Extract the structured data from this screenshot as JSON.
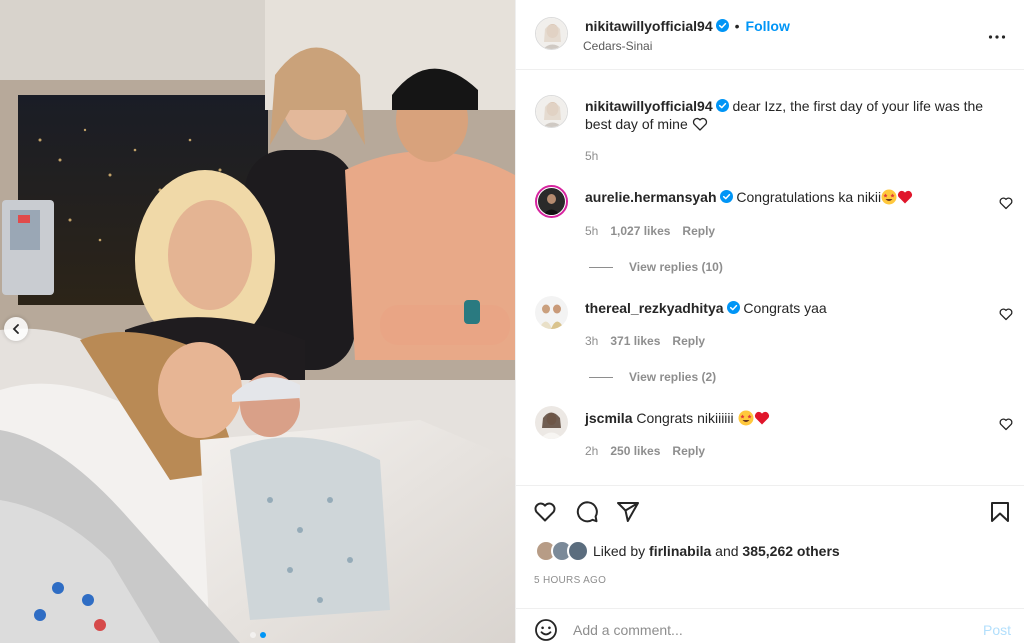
{
  "post": {
    "author": "nikitawillyofficial94",
    "follow_label": "Follow",
    "separator": "•",
    "location": "Cedars-Sinai",
    "caption": {
      "username": "nikitawillyofficial94",
      "text": "dear Izz, the first day of your life was the best day of mine",
      "time": "5h"
    }
  },
  "comments": [
    {
      "username": "aurelie.hermansyah",
      "verified": true,
      "text": "Congratulations ka nikii",
      "emojis": [
        "star-struck-emoji",
        "red-heart-emoji"
      ],
      "time": "5h",
      "likes": "1,027 likes",
      "reply_label": "Reply",
      "view_replies": "View replies (10)"
    },
    {
      "username": "thereal_rezkyadhitya",
      "verified": true,
      "text": "Congrats yaa",
      "emojis": [],
      "time": "3h",
      "likes": "371 likes",
      "reply_label": "Reply",
      "view_replies": "View replies (2)"
    },
    {
      "username": "jscmila",
      "verified": false,
      "text": "Congrats nikiiiiii",
      "emojis": [
        "star-struck-emoji",
        "red-heart-emoji"
      ],
      "time": "2h",
      "likes": "250 likes",
      "reply_label": "Reply",
      "view_replies": ""
    }
  ],
  "actions": {
    "icons": [
      "heart-icon",
      "comment-icon",
      "share-icon",
      "bookmark-icon"
    ],
    "liked_by_prefix": "Liked by ",
    "liked_by_user": "firlinabila",
    "liked_by_middle": " and ",
    "liked_by_count": "385,262 others",
    "timestamp": "5 HOURS AGO"
  },
  "add_comment": {
    "placeholder": "Add a comment...",
    "post_label": "Post"
  },
  "carousel": {
    "total_slides": 2,
    "active_slide": 1
  },
  "colors": {
    "accent": "#0095f6",
    "verified": "#0095f6",
    "muted": "#8e8e8e",
    "border": "#efefef",
    "post_disabled": "#b2dffc"
  }
}
